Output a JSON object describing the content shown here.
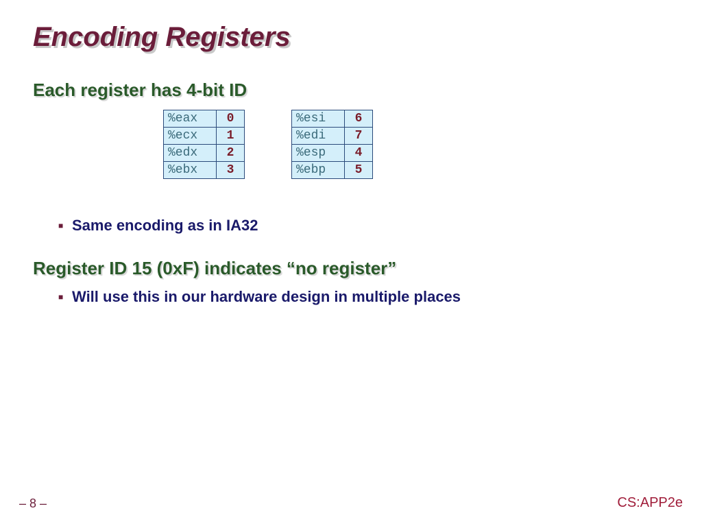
{
  "title": "Encoding Registers",
  "subheading1": "Each register has 4-bit ID",
  "subheading2": "Register ID 15 (0xF) indicates “no register”",
  "bullet1": "Same encoding as in IA32",
  "bullet2": "Will use this in our hardware design in multiple places",
  "left_registers": [
    {
      "name": "%eax",
      "id": "0"
    },
    {
      "name": "%ecx",
      "id": "1"
    },
    {
      "name": "%edx",
      "id": "2"
    },
    {
      "name": "%ebx",
      "id": "3"
    }
  ],
  "right_registers": [
    {
      "name": "%esi",
      "id": "6"
    },
    {
      "name": "%edi",
      "id": "7"
    },
    {
      "name": "%esp",
      "id": "4"
    },
    {
      "name": "%ebp",
      "id": "5"
    }
  ],
  "footer_left": "– 8 –",
  "footer_right": "CS:APP2e"
}
